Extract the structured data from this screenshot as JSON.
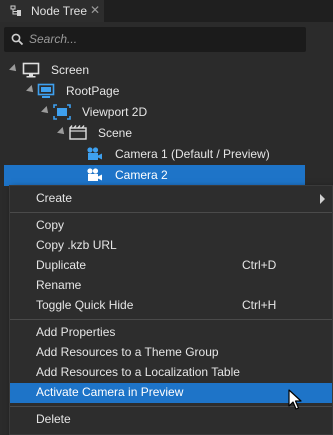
{
  "tab": {
    "title": "Node Tree",
    "close": "✕"
  },
  "search": {
    "placeholder": "Search..."
  },
  "tree": {
    "nodes": [
      {
        "label": "Screen",
        "icon": "monitor-icon"
      },
      {
        "label": "RootPage",
        "icon": "page-icon"
      },
      {
        "label": "Viewport 2D",
        "icon": "viewport-icon"
      },
      {
        "label": "Scene",
        "icon": "scene-icon"
      },
      {
        "label": "Camera 1 (Default / Preview)",
        "icon": "camera-icon"
      },
      {
        "label": "Camera 2",
        "icon": "camera-icon"
      }
    ]
  },
  "menu": {
    "create": "Create",
    "copy": "Copy",
    "copy_kzb_url": "Copy .kzb URL",
    "duplicate": "Duplicate",
    "duplicate_shortcut": "Ctrl+D",
    "rename": "Rename",
    "toggle_quick_hide": "Toggle Quick Hide",
    "toggle_quick_hide_shortcut": "Ctrl+H",
    "add_properties": "Add Properties",
    "add_resources_theme": "Add Resources to a Theme Group",
    "add_resources_localization": "Add Resources to a Localization Table",
    "activate_camera": "Activate Camera in Preview",
    "delete": "Delete"
  },
  "colors": {
    "selection": "#1e74c8",
    "background": "#2b2b2b",
    "icon_blue": "#3ea0ef"
  }
}
